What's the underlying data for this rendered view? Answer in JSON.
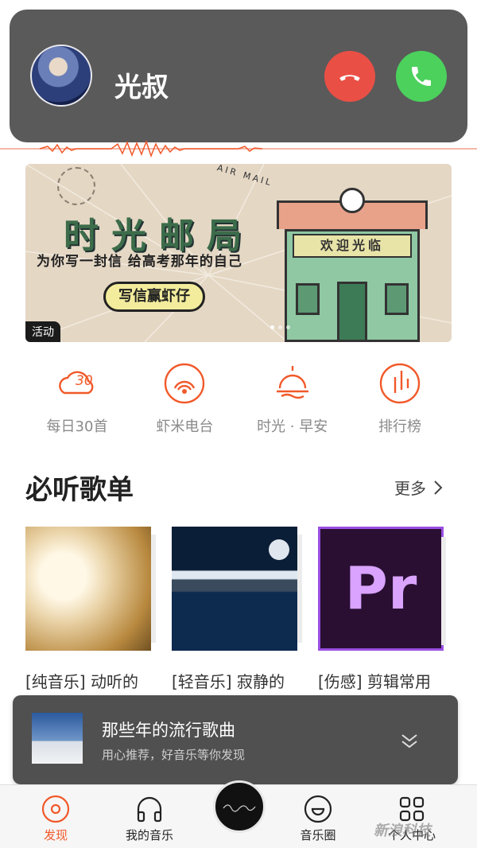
{
  "call": {
    "caller_name": "光叔",
    "decline_icon": "phone-hangup-icon",
    "accept_icon": "phone-icon",
    "decline_color": "#ea4f45",
    "accept_color": "#4cd15d"
  },
  "banner": {
    "title": "时光邮局",
    "subtitle": "为你写一封信 给高考那年的自己",
    "cta": "写信赢虾仔",
    "air_mail": "AIR MAIL",
    "shop_sign": "欢迎光临",
    "tag": "活动"
  },
  "quick_nav": [
    {
      "label": "每日30首",
      "icon": "daily-30-icon"
    },
    {
      "label": "虾米电台",
      "icon": "radio-icon"
    },
    {
      "label": "时光 · 早安",
      "icon": "sunrise-icon"
    },
    {
      "label": "排行榜",
      "icon": "chart-icon"
    }
  ],
  "section": {
    "title": "必听歌单",
    "more": "更多"
  },
  "playlists": [
    {
      "title": "[纯音乐] 动听的旋律"
    },
    {
      "title": "[轻音乐] 寂静的声音~阅读睡…"
    },
    {
      "title": "[伤感] 剪辑常用的悲伤歌曲"
    }
  ],
  "cover3_text": "Pr",
  "now_playing": {
    "song": "那些年的流行歌曲",
    "subtitle": "用心推荐，好音乐等你发现"
  },
  "tabs": [
    {
      "label": "发现",
      "active": true
    },
    {
      "label": "我的音乐"
    },
    {
      "label": "音乐圈"
    },
    {
      "label": "个人中心"
    }
  ],
  "accent_color": "#f1592a",
  "watermark": "新浪科技"
}
